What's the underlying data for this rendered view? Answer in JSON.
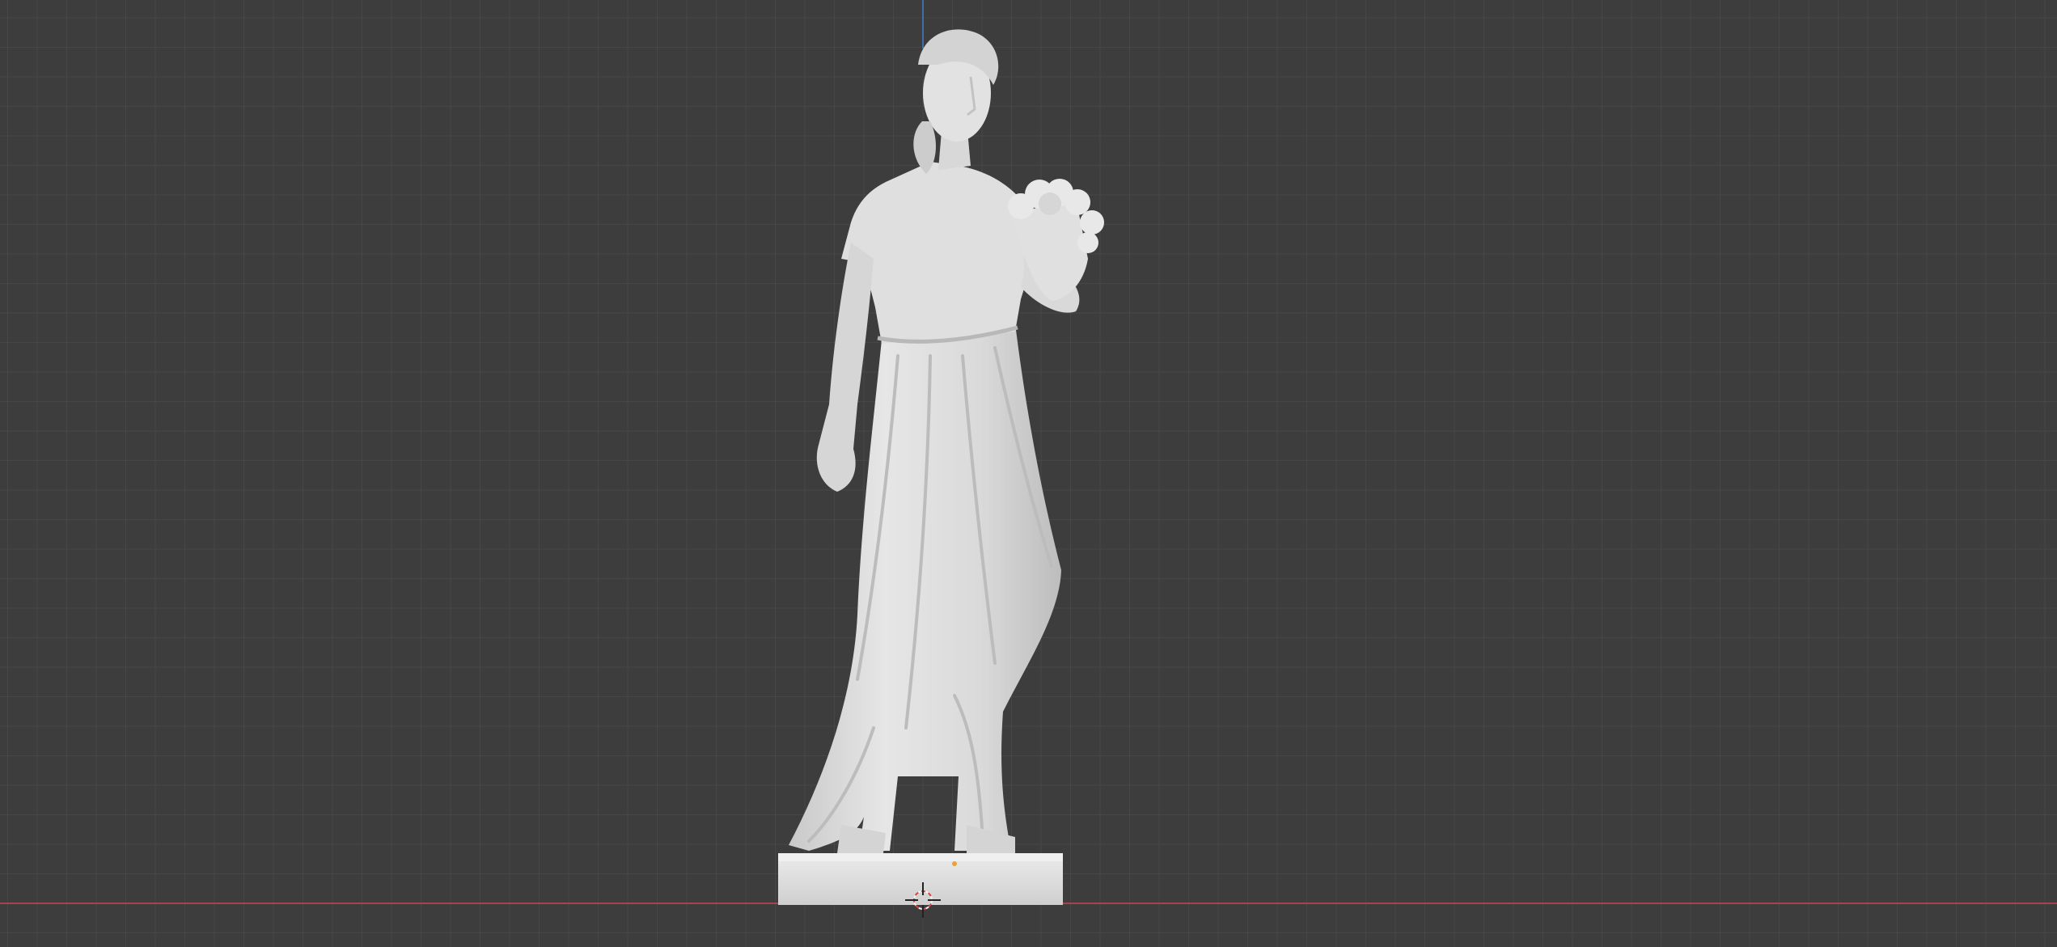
{
  "viewport": {
    "view": "front-orthographic",
    "shading": "solid",
    "background_color": "#3d3d3d",
    "grid_color": "#474747",
    "grid_visible": true,
    "x_axis_color": "#a5444c",
    "z_axis_color": "#3f6eaa",
    "mesh_color": "#d9d9d9"
  },
  "scene": {
    "object": {
      "type": "mesh",
      "description_icon": "statue-mesh",
      "origin_marker_color": "#e8a23a"
    },
    "cursor_icon": "3d-cursor-icon"
  }
}
